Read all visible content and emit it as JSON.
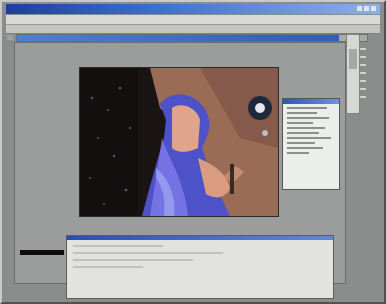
{
  "window": {
    "title_bar_color": "#2c4fae",
    "window_controls": [
      "minimize-icon",
      "maximize-icon",
      "close-icon"
    ]
  },
  "progress": {
    "fraction": 0.92,
    "accent": "#2e5cbf"
  },
  "canvas": {
    "content": "photo-of-woman-in-blue-headscarf"
  },
  "palette": {
    "accent": "#2d57b8"
  },
  "console": {
    "accent": "#2a4fb2"
  },
  "colors": {
    "desktop_bg": "#8a8d8c",
    "panel_light": "#e2e3df"
  }
}
